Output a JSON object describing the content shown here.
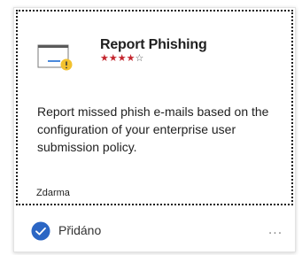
{
  "card": {
    "title": "Report Phishing",
    "rating_stars": {
      "filled": "★★★★",
      "empty": "☆",
      "value": 4,
      "max": 5
    },
    "description": "Report missed phish e-mails based on the configuration of your enterprise user submission policy.",
    "price": "Zdarma",
    "icon": "envelope-warning-icon",
    "status_label": "Přidáno",
    "status_icon": "checkmark-circle-icon",
    "more_label": "...",
    "colors": {
      "star": "#c4262e",
      "check": "#2b66c4",
      "warning": "#f2c12e"
    }
  }
}
